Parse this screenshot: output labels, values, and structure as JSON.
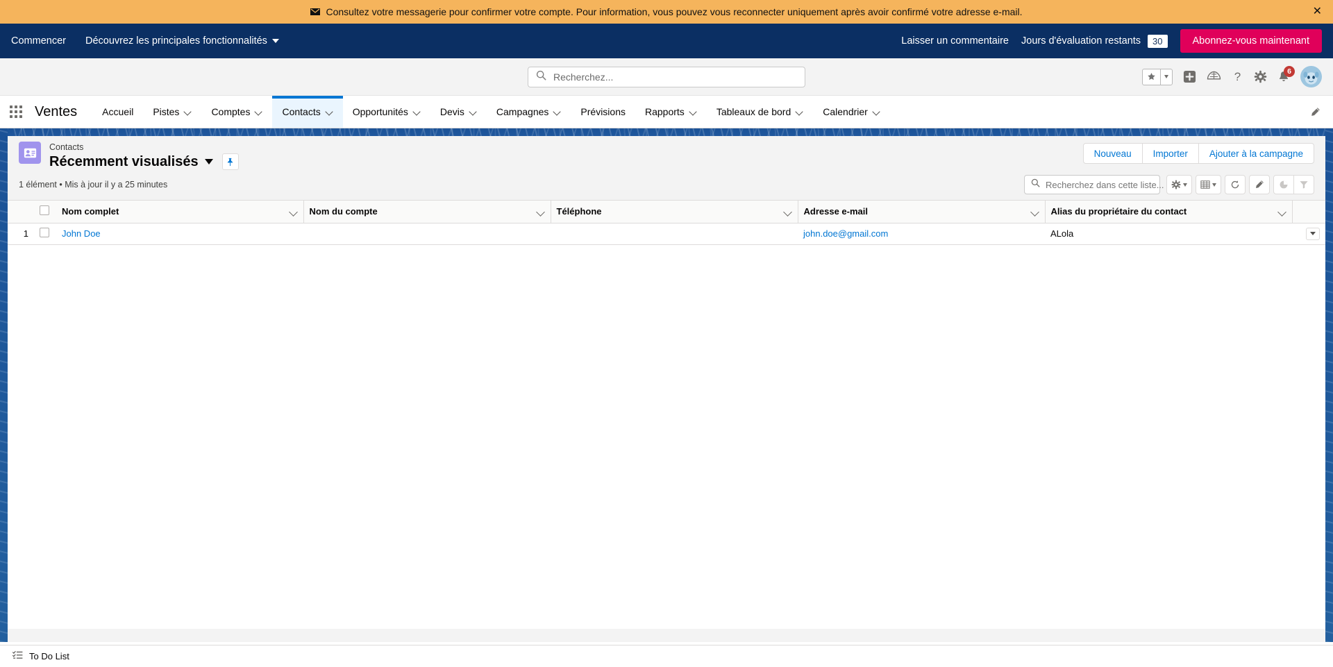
{
  "banner": {
    "icon": "envelope-icon",
    "message": "Consultez votre messagerie pour confirmer votre compte. Pour information, vous pouvez vous reconnecter uniquement après avoir confirmé votre adresse e-mail.",
    "close_label": "✕",
    "bg_color": "#f5b45c"
  },
  "trial_bar": {
    "get_started": "Commencer",
    "discover": "Découvrez les principales fonctionnalités",
    "feedback": "Laisser un commentaire",
    "trial_days_label": "Jours d'évaluation restants",
    "trial_days_count": "30",
    "subscribe": "Abonnez-vous maintenant",
    "bg_color": "#0b2f63",
    "subscribe_color": "#e0005a"
  },
  "global_header": {
    "search_placeholder": "Recherchez...",
    "search_value": "",
    "notifications_count": "6"
  },
  "app_nav": {
    "app_name": "Ventes",
    "items": [
      {
        "label": "Accueil",
        "has_menu": false,
        "active": false
      },
      {
        "label": "Pistes",
        "has_menu": true,
        "active": false
      },
      {
        "label": "Comptes",
        "has_menu": true,
        "active": false
      },
      {
        "label": "Contacts",
        "has_menu": true,
        "active": true
      },
      {
        "label": "Opportunités",
        "has_menu": true,
        "active": false
      },
      {
        "label": "Devis",
        "has_menu": true,
        "active": false
      },
      {
        "label": "Campagnes",
        "has_menu": true,
        "active": false
      },
      {
        "label": "Prévisions",
        "has_menu": false,
        "active": false
      },
      {
        "label": "Rapports",
        "has_menu": true,
        "active": false
      },
      {
        "label": "Tableaux de bord",
        "has_menu": true,
        "active": false
      },
      {
        "label": "Calendrier",
        "has_menu": true,
        "active": false
      }
    ]
  },
  "list_view": {
    "object_label": "Contacts",
    "view_name": "Récemment visualisés",
    "icon_color": "#a094ed",
    "buttons": [
      {
        "label": "Nouveau"
      },
      {
        "label": "Importer"
      },
      {
        "label": "Ajouter à la campagne"
      }
    ],
    "record_count_text": "1 élément • Mis à jour il y a 25 minutes",
    "list_search_placeholder": "Recherchez dans cette liste...",
    "list_search_value": "",
    "columns": [
      {
        "label": "Nom complet"
      },
      {
        "label": "Nom du compte"
      },
      {
        "label": "Téléphone"
      },
      {
        "label": "Adresse e-mail"
      },
      {
        "label": "Alias du propriétaire du contact"
      }
    ],
    "rows": [
      {
        "index": "1",
        "full_name": "John Doe",
        "account_name": "",
        "phone": "",
        "email": "john.doe@gmail.com",
        "owner_alias": "ALola"
      }
    ]
  },
  "utility_bar": {
    "items": [
      {
        "label": "To Do List",
        "icon": "todo-list-icon"
      }
    ]
  }
}
